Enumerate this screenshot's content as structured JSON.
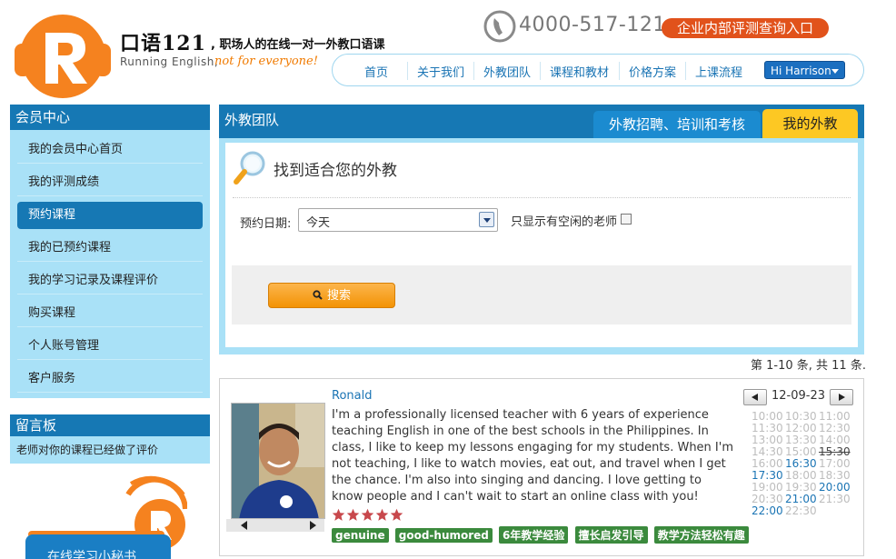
{
  "header": {
    "brand_title": "口语121",
    "brand_slogan": ", 职场人的在线一对一外教口语课",
    "brand_en": "Running English,",
    "brand_tagline": "not for everyone!",
    "phone": "4000-517-121",
    "enterprise_button": "企业内部评测查询入口"
  },
  "nav": {
    "items": [
      "首页",
      "关于我们",
      "外教团队",
      "课程和教材",
      "价格方案",
      "上课流程"
    ],
    "user_button": "Hi Harrison"
  },
  "sidebar": {
    "title": "会员中心",
    "items": [
      "我的会员中心首页",
      "我的评测成绩",
      "预约课程",
      "我的已预约课程",
      "我的学习记录及课程评价",
      "购买课程",
      "个人账号管理",
      "客户服务"
    ],
    "active_index": 2
  },
  "message_board": {
    "title": "留言板",
    "text": "老师对你的课程已经做了评价"
  },
  "helper": {
    "label": "在线学习小秘书"
  },
  "main": {
    "title": "外教团队",
    "tab_recruit": "外教招聘、培训和考核",
    "tab_mine": "我的外教",
    "search_heading": "找到适合您的外教",
    "date_label": "预约日期:",
    "date_value": "今天",
    "free_only_label": "只显示有空闲的老师",
    "search_button": "搜索",
    "results_count": "第 1-10 条, 共 11 条."
  },
  "teacher": {
    "name": "Ronald",
    "bio": "I'm a professionally licensed teacher with 6 years of experience teaching English in one of the best schools in the Philippines. In class, I like to keep my lessons engaging for my students. When I'm not teaching, I like to watch movies, eat out, and travel when I get the chance. I'm also into singing and dancing. I love getting to know people and I can't wait to start an online class with you!",
    "rating": 5,
    "tags": [
      "genuine",
      "good-humored",
      "6年教学经验",
      "擅长启发引导",
      "教学方法轻松有趣"
    ],
    "schedule_date": "12-09-23",
    "slots": [
      {
        "t": "10:00",
        "s": "off"
      },
      {
        "t": "10:30",
        "s": "off"
      },
      {
        "t": "11:00",
        "s": "off"
      },
      {
        "t": "11:30",
        "s": "off"
      },
      {
        "t": "12:00",
        "s": "off"
      },
      {
        "t": "12:30",
        "s": "off"
      },
      {
        "t": "13:00",
        "s": "off"
      },
      {
        "t": "13:30",
        "s": "off"
      },
      {
        "t": "14:00",
        "s": "off"
      },
      {
        "t": "14:30",
        "s": "off"
      },
      {
        "t": "15:00",
        "s": "off"
      },
      {
        "t": "15:30",
        "s": "struck"
      },
      {
        "t": "16:00",
        "s": "off"
      },
      {
        "t": "16:30",
        "s": "on"
      },
      {
        "t": "17:00",
        "s": "off"
      },
      {
        "t": "17:30",
        "s": "on"
      },
      {
        "t": "18:00",
        "s": "off"
      },
      {
        "t": "18:30",
        "s": "off"
      },
      {
        "t": "19:00",
        "s": "off"
      },
      {
        "t": "19:30",
        "s": "off"
      },
      {
        "t": "20:00",
        "s": "on"
      },
      {
        "t": "20:30",
        "s": "off"
      },
      {
        "t": "21:00",
        "s": "on"
      },
      {
        "t": "21:30",
        "s": "off"
      },
      {
        "t": "22:00",
        "s": "on"
      },
      {
        "t": "22:30",
        "s": "off"
      }
    ]
  },
  "colors": {
    "primary_blue": "#1678b4",
    "light_blue": "#a9e1f7",
    "accent_orange": "#f39305",
    "enterprise_red": "#e1521b",
    "tab_yellow": "#fdc823",
    "tag_green": "#3b8a3d",
    "star_red": "#c8484c"
  }
}
